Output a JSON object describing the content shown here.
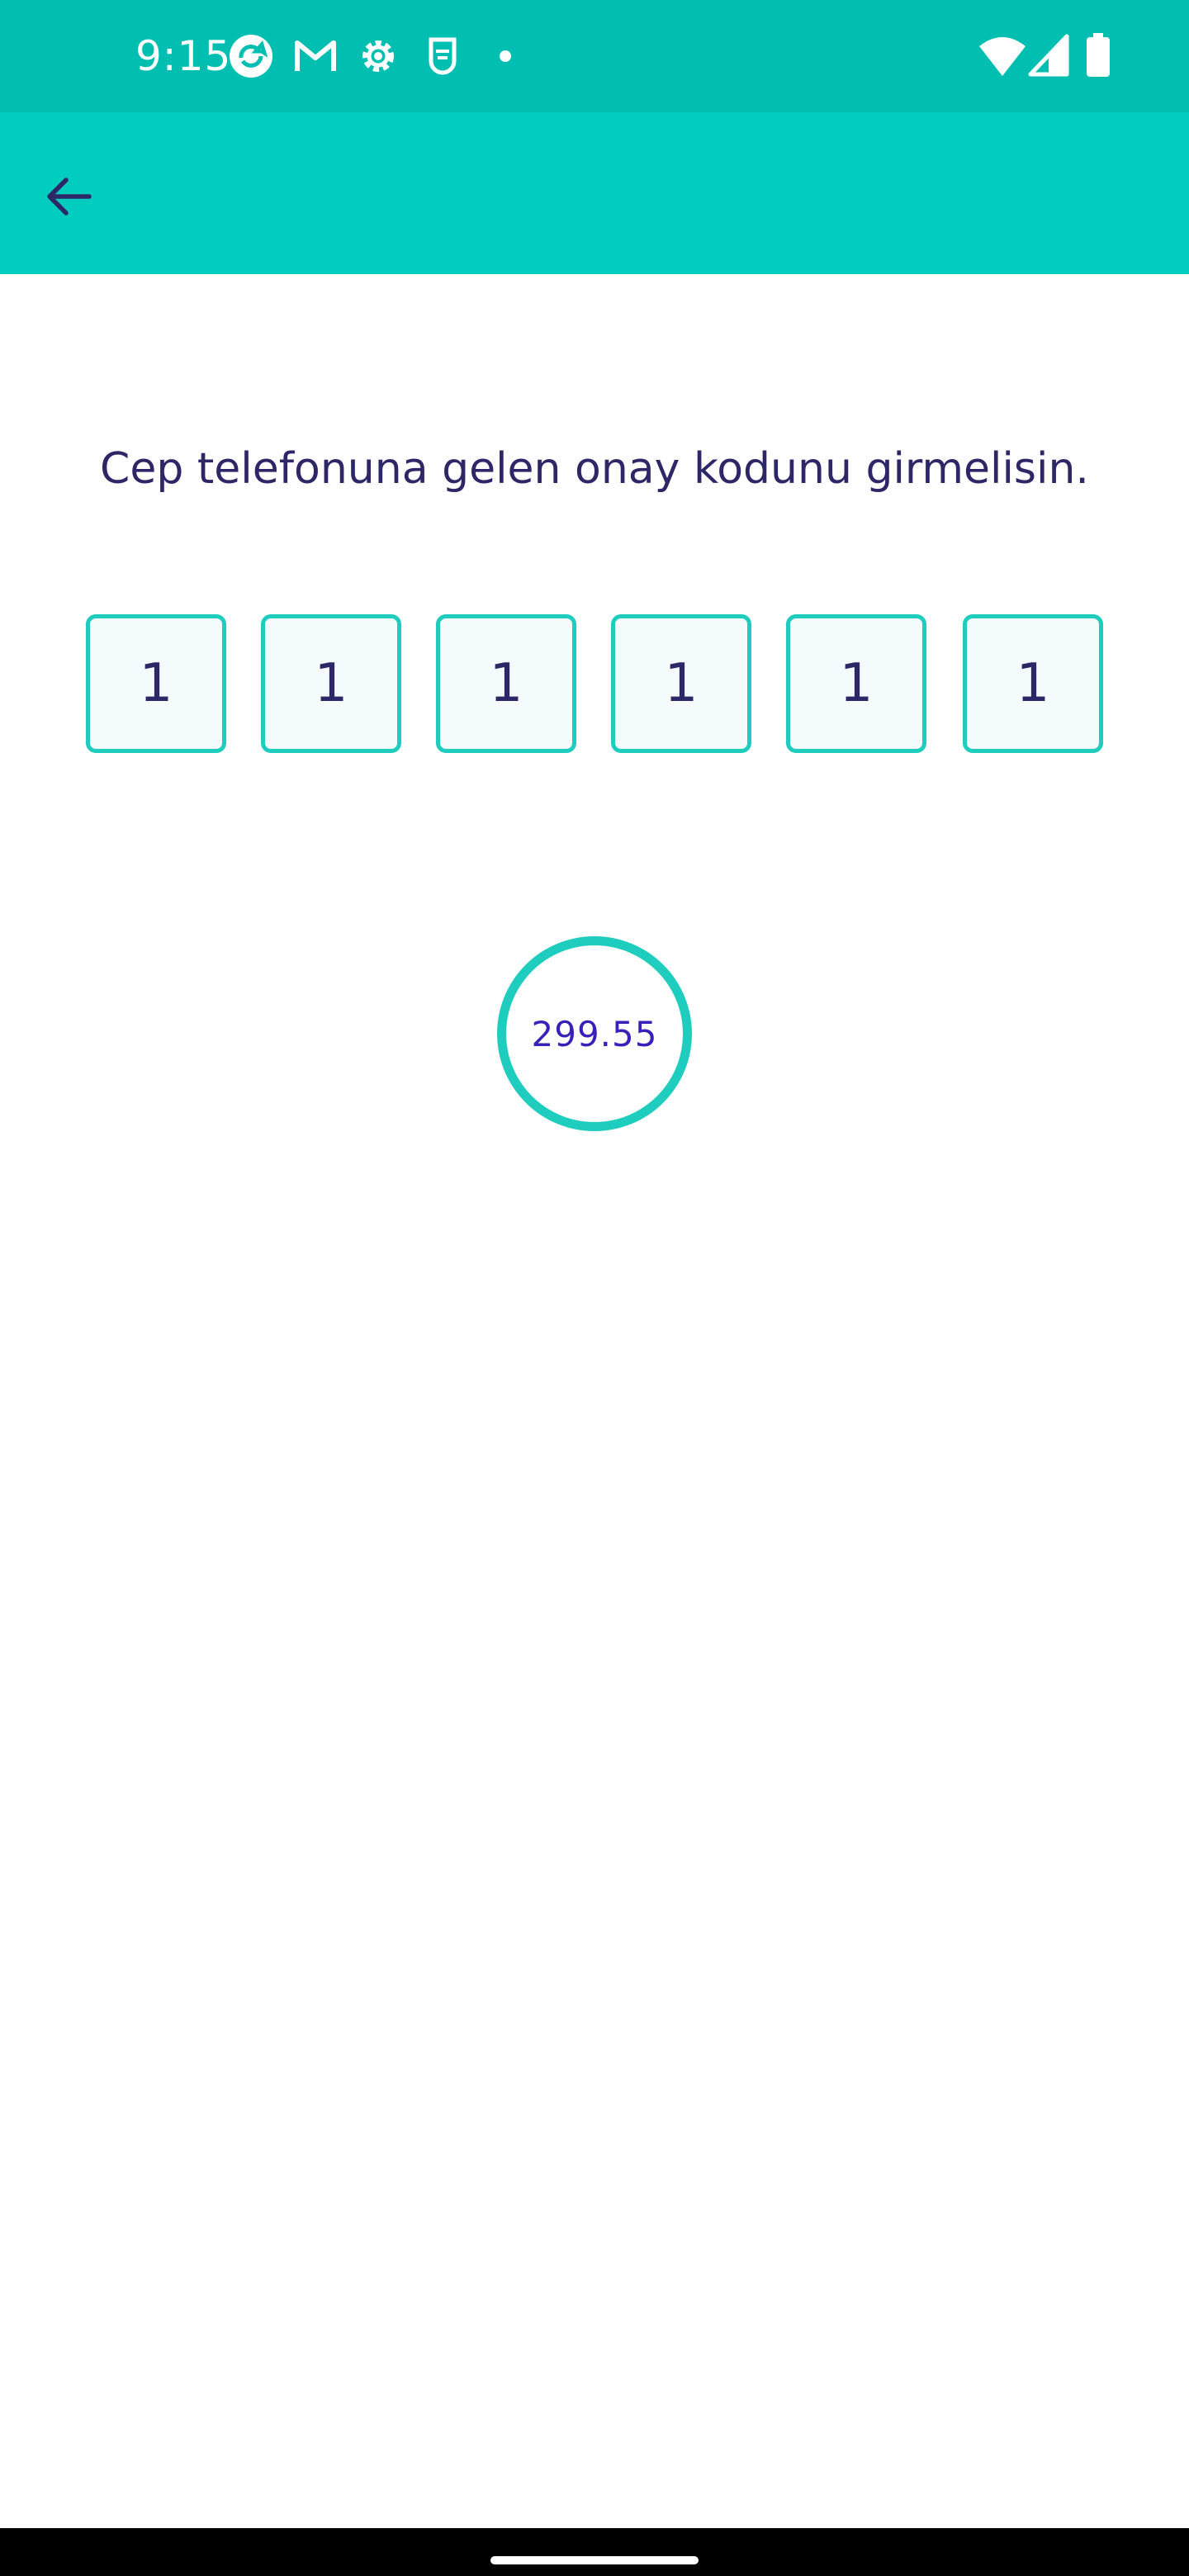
{
  "status_bar": {
    "time": "9:15",
    "left_icons": [
      "sync-app-icon",
      "gmail-icon",
      "settings-icon",
      "shield-app-icon",
      "dot-icon"
    ],
    "right_icons": [
      "wifi-icon",
      "cellular-signal-icon",
      "battery-icon"
    ]
  },
  "header": {
    "back_icon": "arrow-back-icon"
  },
  "verification": {
    "instruction": "Cep telefonuna gelen onay kodunu girmelisin.",
    "code_digits": [
      "1",
      "1",
      "1",
      "1",
      "1",
      "1"
    ]
  },
  "timer": {
    "value": "299.55"
  },
  "colors": {
    "status_bar": "#00BFB0",
    "app_bar": "#00CDBD",
    "accent": "#1FCDBE",
    "text_primary": "#2E2767",
    "timer_text": "#3A1FB8",
    "box_fill": "#F3FBFC"
  }
}
